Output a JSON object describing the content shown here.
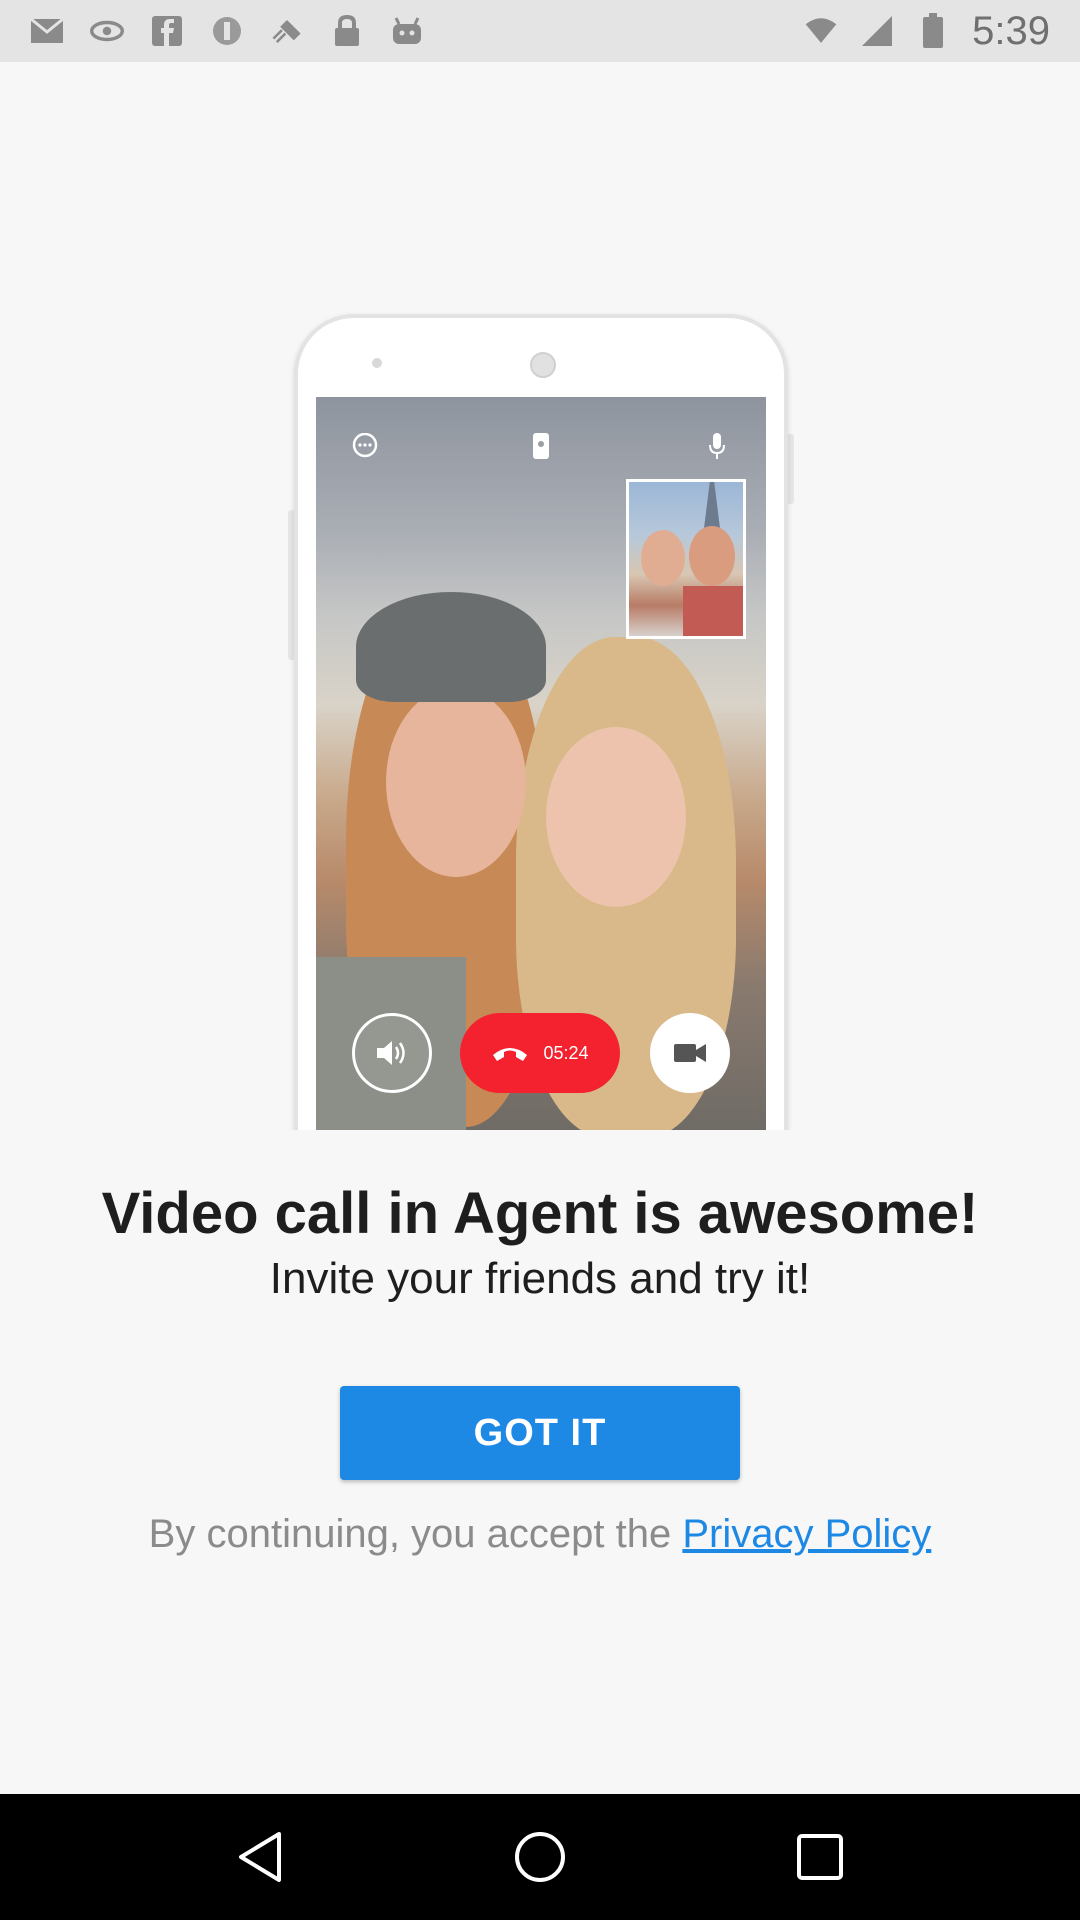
{
  "status_bar": {
    "time": "5:39",
    "icons": [
      "mail-icon",
      "nvidia-icon",
      "facebook-icon",
      "circle-icon",
      "fake-gps-icon",
      "lock-icon",
      "android-icon",
      "wifi-icon",
      "signal-icon",
      "battery-icon"
    ]
  },
  "illustration": {
    "call_timer": "05:24",
    "screen_icons": [
      "chat-icon",
      "switch-camera-icon",
      "mic-icon"
    ],
    "controls": [
      "speaker-icon",
      "end-call-icon",
      "video-camera-icon"
    ]
  },
  "onboarding": {
    "headline": "Video call in Agent is awesome!",
    "subline": "Invite your friends and try it!",
    "got_it_label": "GOT IT",
    "consent_prefix": "By continuing, you accept the",
    "privacy_link": "Privacy Policy"
  },
  "colors": {
    "accent": "#1e88e5",
    "end_call": "#f4212e",
    "background": "#f7f7f7"
  }
}
